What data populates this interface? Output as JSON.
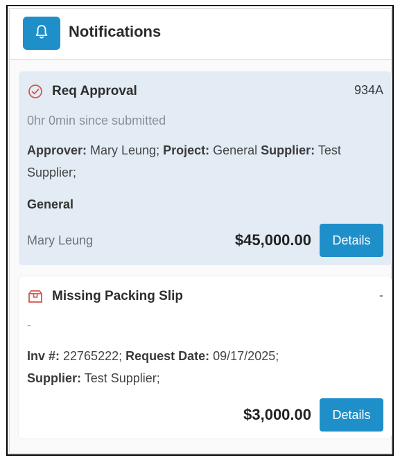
{
  "header": {
    "title": "Notifications",
    "icon": "bell-icon",
    "accent": "#1f8fc9"
  },
  "notifications": [
    {
      "icon": "check-circle-icon",
      "icon_color": "#d9534f",
      "title": "Req Approval",
      "id": "934A",
      "meta": "0hr 0min since submitted",
      "details": [
        {
          "label": "Approver:",
          "value": " Mary Leung; "
        },
        {
          "label": "Project:",
          "value": " General "
        },
        {
          "label": "Supplier:",
          "value": " Test Supplier;"
        }
      ],
      "category": "General",
      "person": "Mary Leung",
      "amount": "$45,000.00",
      "button": "Details"
    },
    {
      "icon": "box-icon",
      "icon_color": "#d9534f",
      "title": "Missing Packing Slip",
      "id": "-",
      "meta": "-",
      "details": [
        {
          "label": "Inv #:",
          "value": " 22765222; "
        },
        {
          "label": "Request Date:",
          "value": " 09/17/2025;"
        },
        {
          "label": "Supplier:",
          "value": " Test Supplier;"
        }
      ],
      "amount": "$3,000.00",
      "button": "Details"
    }
  ]
}
